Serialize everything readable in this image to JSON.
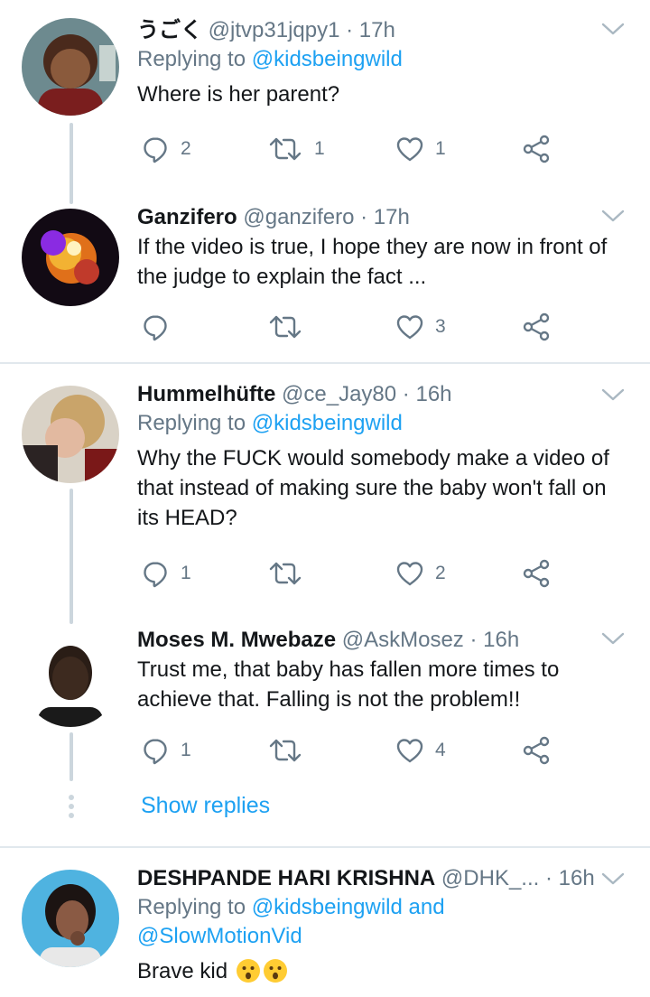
{
  "tweets": [
    {
      "name": "うごく",
      "handle": "@jtvp31jqpy1",
      "dot": "·",
      "time": "17h",
      "replying_prefix": "Replying to ",
      "replying_to": "@kidsbeingwild",
      "text": "Where is her parent?",
      "replies": "2",
      "retweets": "1",
      "likes": "1"
    },
    {
      "name": "Ganzifero",
      "handle": "@ganzifero",
      "dot": "·",
      "time": "17h",
      "text_line1": "If the video is true, I hope they are now in front of",
      "text_line2": "the judge to explain the fact ...",
      "replies": "",
      "retweets": "",
      "likes": "3"
    },
    {
      "name": "Hummelhüfte",
      "handle": "@ce_Jay80",
      "dot": "·",
      "time": "16h",
      "replying_prefix": "Replying to ",
      "replying_to": "@kidsbeingwild",
      "text_line1": "Why the FUCK would somebody make a video of",
      "text_line2": "that instead of making sure the baby won't fall on",
      "text_line3": "its HEAD?",
      "replies": "1",
      "retweets": "",
      "likes": "2"
    },
    {
      "name": "Moses M. Mwebaze",
      "handle": "@AskMosez",
      "dot": "·",
      "time": "16h",
      "text_line1": "Trust me, that baby has fallen more times to",
      "text_line2": "achieve that. Falling is not the problem!!",
      "replies": "1",
      "retweets": "",
      "likes": "4"
    },
    {
      "name": "DESHPANDE HARI KRISHNA",
      "handle": "@DHK_...",
      "dot": "·",
      "time": "16h",
      "replying_prefix": "Replying to ",
      "replying_to": "@kidsbeingwild and",
      "replying_to2": "@SlowMotionVid",
      "text": "Brave kid"
    }
  ],
  "show_replies": "Show replies",
  "colors": {
    "link": "#1da1f2",
    "muted": "#657786",
    "thread_line": "#ccd6dd",
    "divider": "#e1e8ed"
  },
  "icons": [
    "reply-icon",
    "retweet-icon",
    "like-icon",
    "share-icon",
    "chevron-down-icon",
    "astonished-face-emoji"
  ]
}
